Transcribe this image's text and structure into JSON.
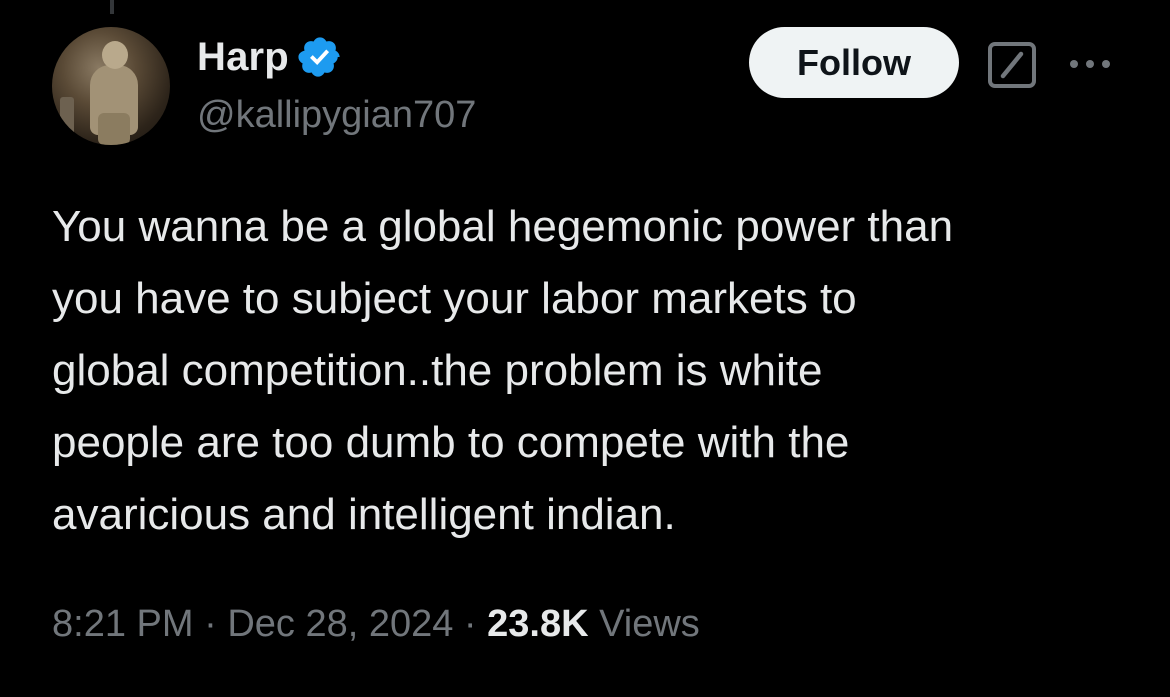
{
  "author": {
    "display_name": "Harp",
    "handle": "@kallipygian707",
    "verified": true
  },
  "actions": {
    "follow_label": "Follow",
    "grok_icon": "grok-icon",
    "more_icon": "more-icon"
  },
  "tweet": {
    "text": "You wanna be a global hegemonic power than\nyou have to subject your labor markets to\nglobal competition..the problem is white\npeople are too dumb to compete with the\navaricious and intelligent indian."
  },
  "meta": {
    "time": "8:21 PM",
    "separator": " · ",
    "date": "Dec 28, 2024",
    "views_count": "23.8K",
    "views_label": " Views"
  },
  "colors": {
    "background": "#000000",
    "text_primary": "#e7e9ea",
    "text_secondary": "#71767b",
    "verified_blue": "#1d9bf0",
    "follow_bg": "#eff3f4"
  }
}
